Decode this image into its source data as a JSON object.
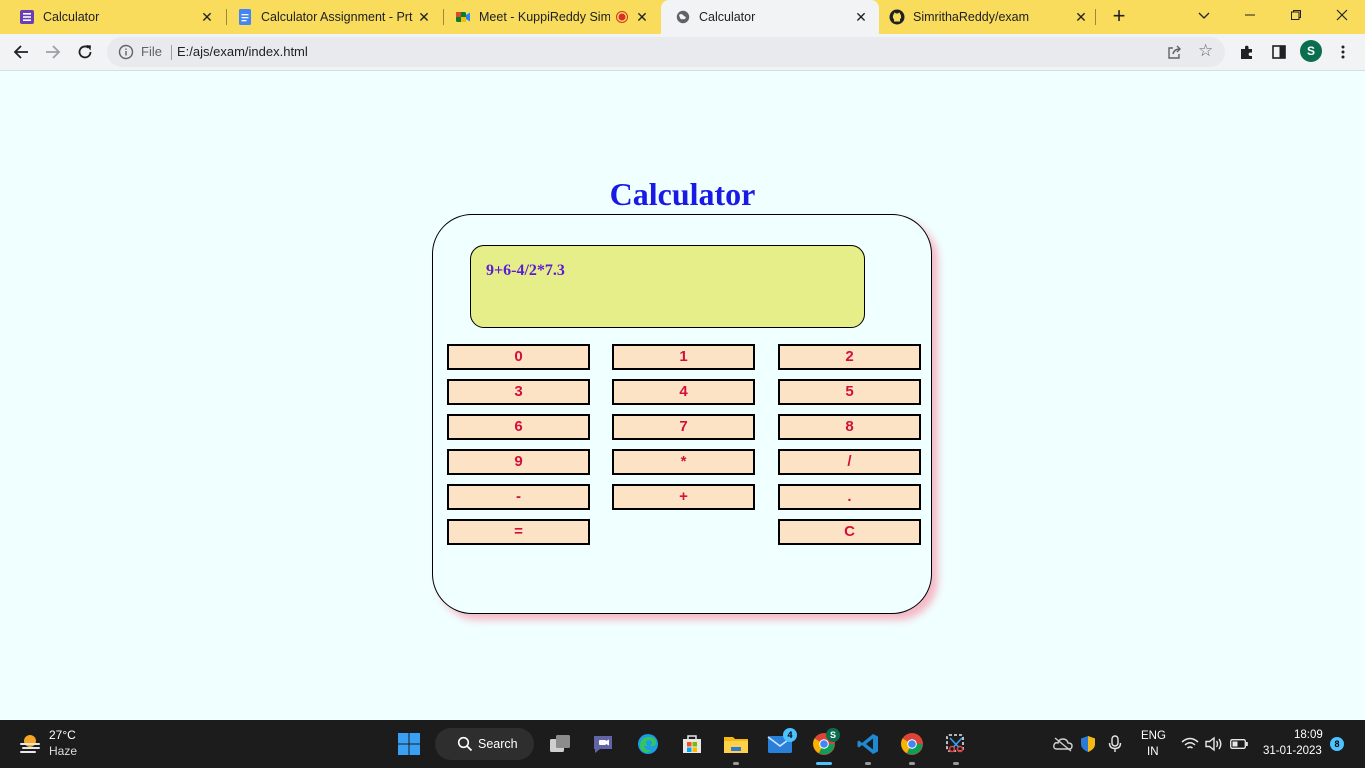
{
  "browser": {
    "tabs": [
      {
        "title": "Calculator",
        "icon": "tasks-list-icon",
        "active": false
      },
      {
        "title": "Calculator Assignment - Prt -",
        "icon": "docs-icon",
        "active": false
      },
      {
        "title": "Meet - KuppiReddy Simr",
        "icon": "meet-icon",
        "active": false
      },
      {
        "title": "Calculator",
        "icon": "globe-icon",
        "active": true
      },
      {
        "title": "SimrithaReddy/exam",
        "icon": "github-icon",
        "active": false
      }
    ],
    "new_tab_label": "+",
    "omnibox": {
      "scheme_label": "File",
      "url": "E:/ajs/exam/index.html"
    },
    "avatar_letter": "S",
    "colors": {
      "tab_strip": "#f9dc5c",
      "toolbar": "#f1f3f4"
    }
  },
  "page": {
    "title": "Calculator",
    "display": "9+6-4/2*7.3",
    "keys": [
      "0",
      "1",
      "2",
      "3",
      "4",
      "5",
      "6",
      "7",
      "8",
      "9",
      "*",
      "/",
      "-",
      "+",
      ".",
      "=",
      "C"
    ],
    "colors": {
      "title": "#1a1ae6",
      "display_bg": "#e6ee8a",
      "key_bg": "#fde3c6",
      "key_text": "#d4103a",
      "shadow": "#f5b9c6"
    }
  },
  "taskbar": {
    "weather": {
      "temp": "27°C",
      "condition": "Haze"
    },
    "search_label": "Search",
    "mail_badge": "4",
    "chrome_profile_badge": "S",
    "lang_line1": "ENG",
    "lang_line2": "IN",
    "time": "18:09",
    "date": "31-01-2023",
    "notification_count": "8"
  }
}
